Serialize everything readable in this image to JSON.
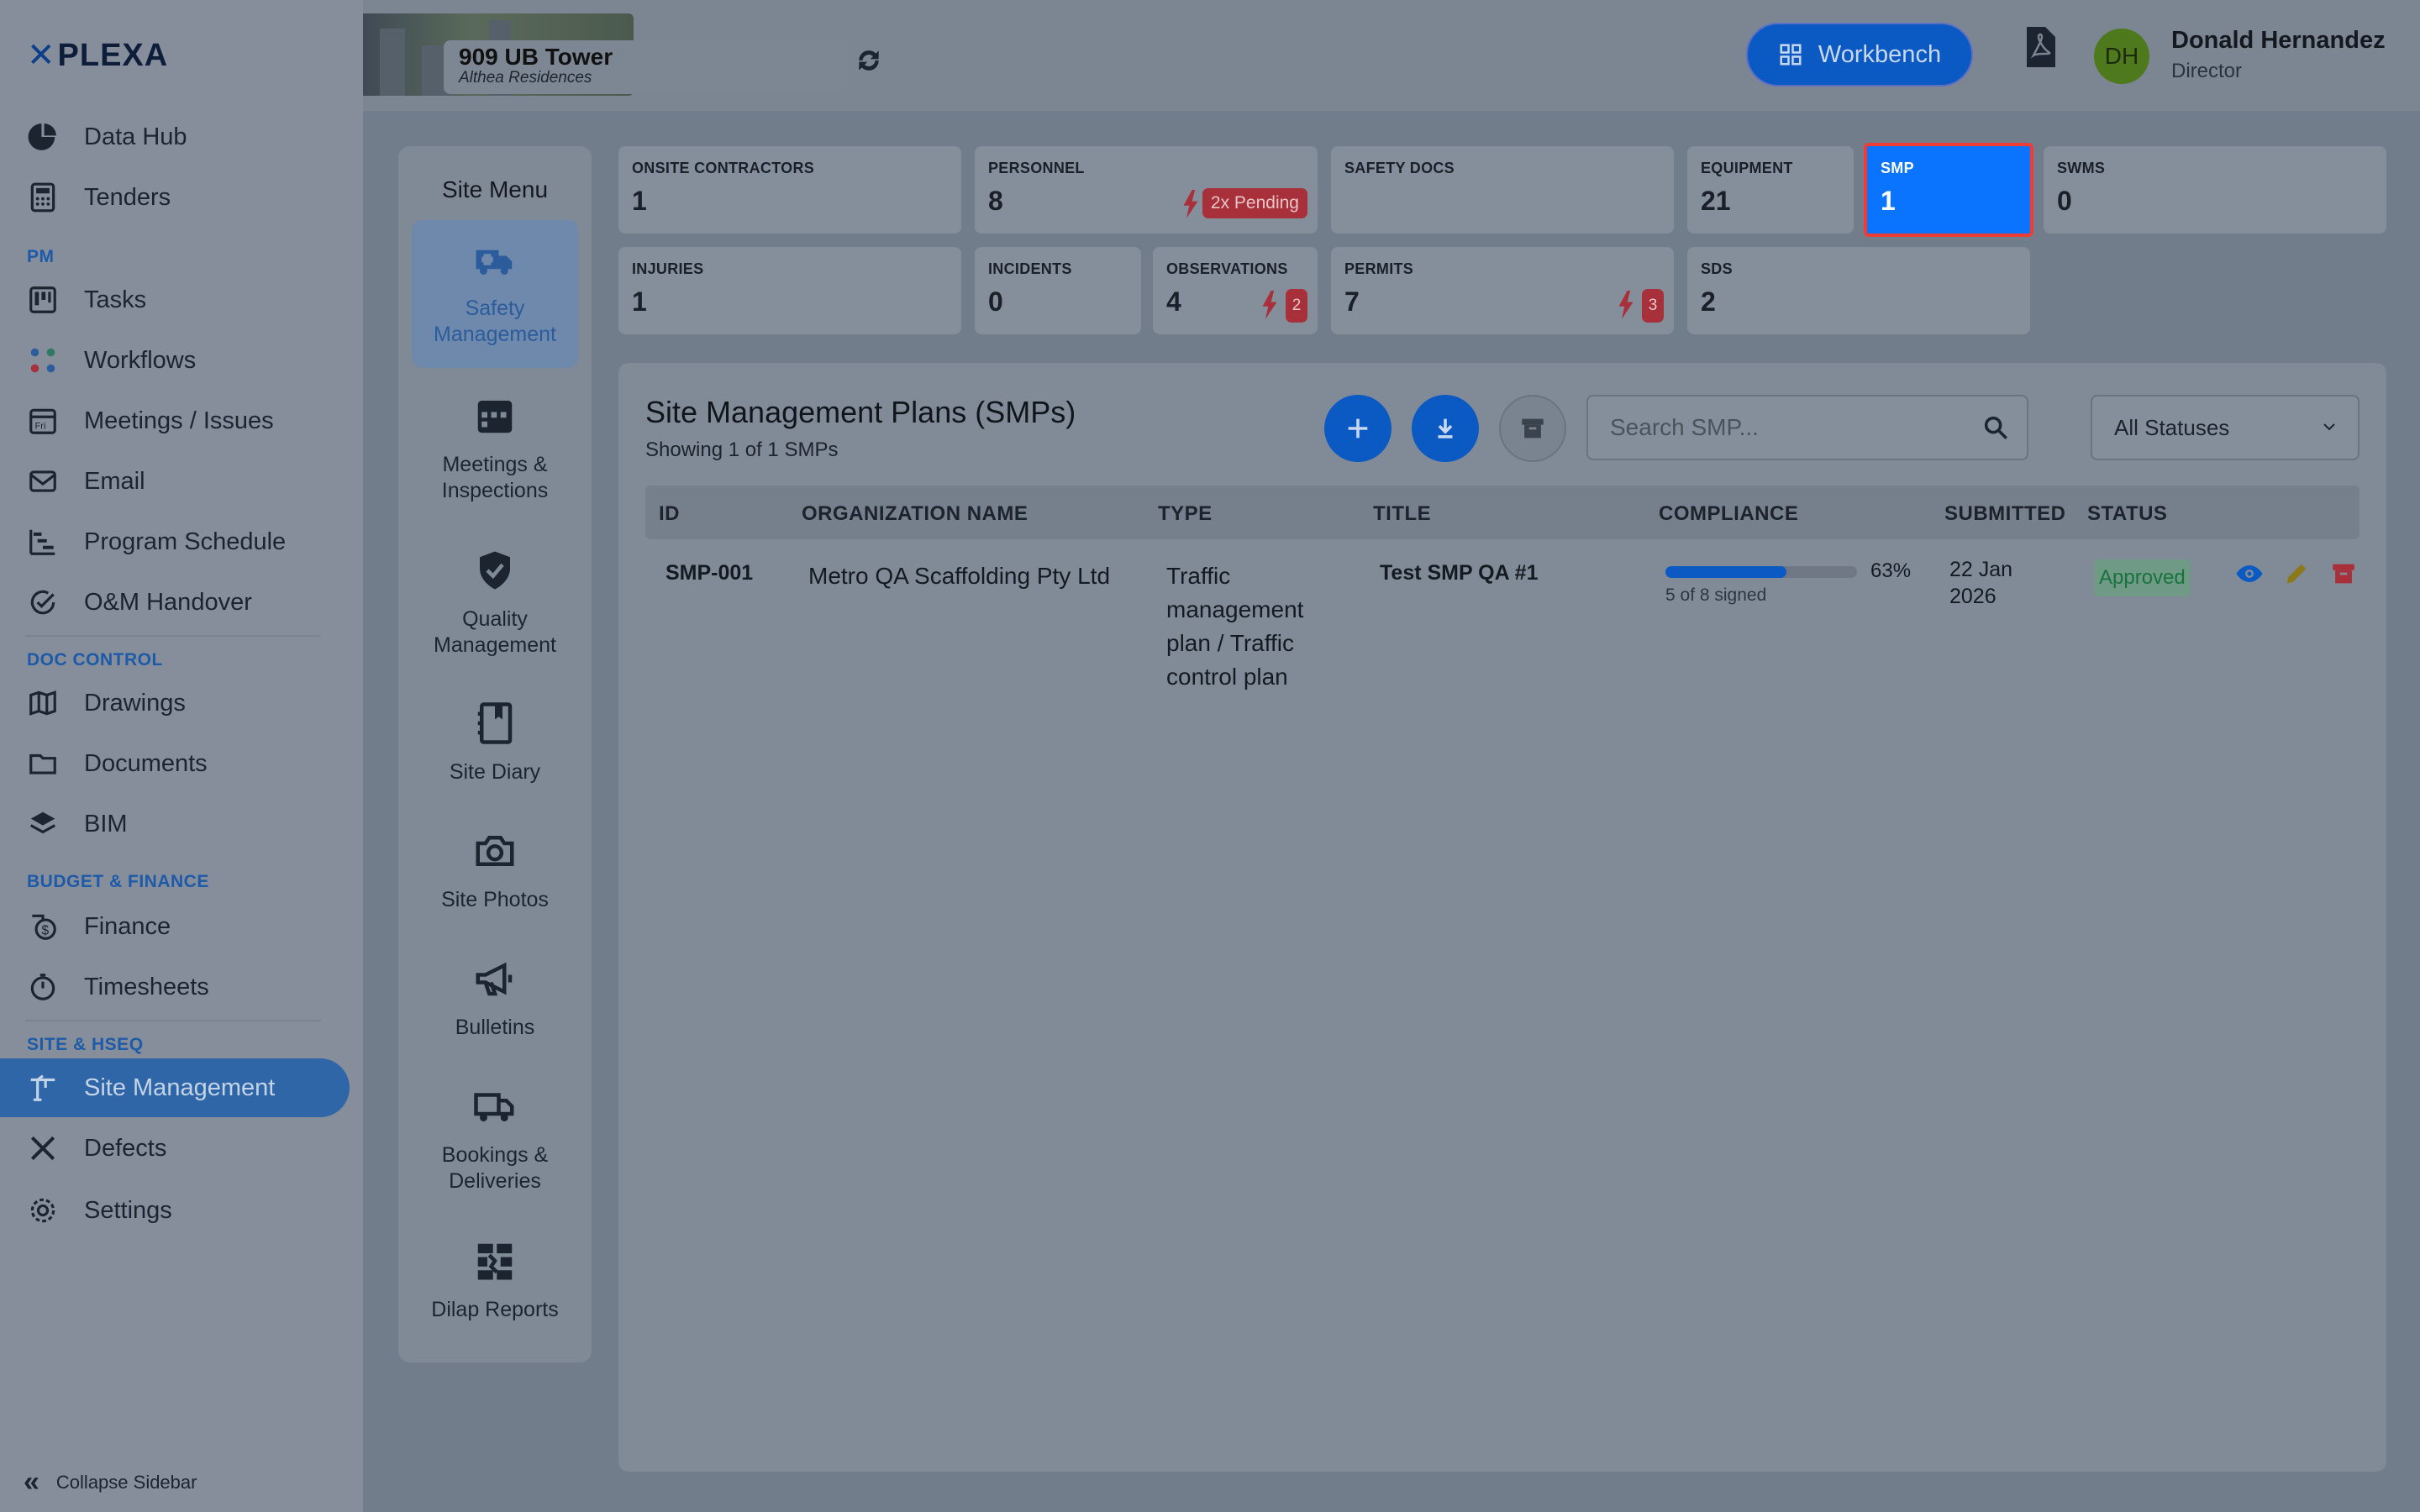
{
  "app": {
    "logo_text": "PLEXA"
  },
  "sidebar": {
    "items": [
      {
        "label": "Data Hub",
        "icon": "pie-chart-icon"
      },
      {
        "label": "Tenders",
        "icon": "calculator-icon"
      },
      {
        "label": "Tasks",
        "icon": "kanban-icon"
      },
      {
        "label": "Workflows",
        "icon": "workflow-icon"
      },
      {
        "label": "Meetings / Issues",
        "icon": "calendar-icon"
      },
      {
        "label": "Email",
        "icon": "envelope-icon"
      },
      {
        "label": "Program Schedule",
        "icon": "gantt-icon"
      },
      {
        "label": "O&M Handover",
        "icon": "check-circle-icon"
      },
      {
        "label": "Drawings",
        "icon": "map-icon"
      },
      {
        "label": "Documents",
        "icon": "folder-icon"
      },
      {
        "label": "BIM",
        "icon": "layers-icon"
      },
      {
        "label": "Finance",
        "icon": "finance-icon"
      },
      {
        "label": "Timesheets",
        "icon": "stopwatch-icon"
      },
      {
        "label": "Site Management",
        "icon": "crane-icon"
      },
      {
        "label": "Defects",
        "icon": "tools-icon"
      },
      {
        "label": "Settings",
        "icon": "gear-icon"
      }
    ],
    "sections": {
      "pm": "PM",
      "doc_control": "DOC CONTROL",
      "budget": "BUDGET & FINANCE",
      "site": "SITE & HSEQ"
    },
    "collapse_label": "Collapse Sidebar"
  },
  "header": {
    "project_name": "909 UB Tower",
    "project_sub": "Althea Residences",
    "workbench_label": "Workbench",
    "user_initials": "DH",
    "user_name": "Donald Hernandez",
    "user_role": "Director"
  },
  "site_menu": {
    "title": "Site Menu",
    "items": [
      {
        "label": "Safety Management",
        "icon": "ambulance-icon"
      },
      {
        "label": "Meetings & Inspections",
        "icon": "calendar-icon"
      },
      {
        "label": "Quality Management",
        "icon": "shield-check-icon"
      },
      {
        "label": "Site Diary",
        "icon": "diary-icon"
      },
      {
        "label": "Site Photos",
        "icon": "camera-icon"
      },
      {
        "label": "Bulletins",
        "icon": "megaphone-icon"
      },
      {
        "label": "Bookings & Deliveries",
        "icon": "truck-icon"
      },
      {
        "label": "Dilap Reports",
        "icon": "broken-wall-icon"
      }
    ]
  },
  "stats": [
    {
      "label": "ONSITE CONTRACTORS",
      "value": "1"
    },
    {
      "label": "PERSONNEL",
      "value": "8",
      "pending": "2x Pending"
    },
    {
      "label": "SAFETY DOCS",
      "value": ""
    },
    {
      "label": "EQUIPMENT",
      "value": "21"
    },
    {
      "label": "SMP",
      "value": "1"
    },
    {
      "label": "SWMS",
      "value": "0"
    },
    {
      "label": "INJURIES",
      "value": "1"
    },
    {
      "label": "INCIDENTS",
      "value": "0"
    },
    {
      "label": "OBSERVATIONS",
      "value": "4",
      "alert_count": "2"
    },
    {
      "label": "PERMITS",
      "value": "7",
      "alert_count": "3"
    },
    {
      "label": "SDS",
      "value": "2"
    }
  ],
  "panel": {
    "title": "Site Management Plans (SMPs)",
    "subtitle": "Showing 1 of 1 SMPs",
    "search_placeholder": "Search SMP...",
    "status_filter": "All Statuses",
    "columns": [
      "ID",
      "ORGANIZATION NAME",
      "TYPE",
      "TITLE",
      "COMPLIANCE",
      "SUBMITTED",
      "STATUS"
    ],
    "rows": [
      {
        "id": "SMP-001",
        "organization": "Metro QA Scaffolding Pty Ltd",
        "type_lines": [
          "Traffic",
          "management",
          "plan / Traffic",
          "control plan"
        ],
        "title": "Test SMP QA #1",
        "compliance_pct": "63%",
        "compliance_fraction": 0.63,
        "compliance_note": "5 of 8 signed",
        "submitted_lines": [
          "22 Jan",
          "2026"
        ],
        "status": "Approved"
      }
    ]
  },
  "colors": {
    "accent": "#0b59c2",
    "active_stat": "#0a74ff",
    "alert": "#a8303a",
    "approved": "#18733e"
  }
}
